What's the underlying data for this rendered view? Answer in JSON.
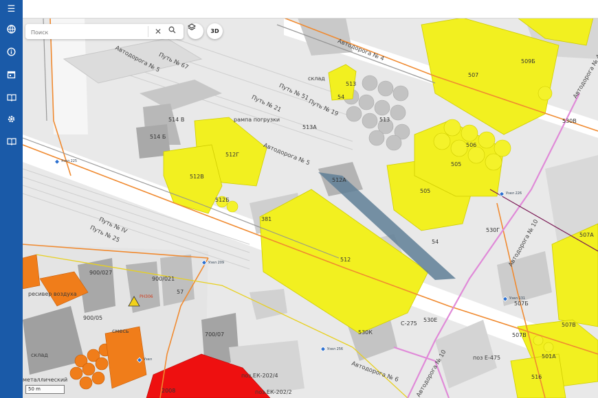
{
  "sidebar": {
    "items": [
      {
        "name": "menu-icon",
        "glyph": "☰"
      },
      {
        "name": "globe-icon",
        "glyph": "🌐"
      },
      {
        "name": "info-icon",
        "glyph": "ⓘ"
      },
      {
        "name": "calendar-icon",
        "glyph": "▦"
      },
      {
        "name": "book-icon",
        "glyph": "📖"
      },
      {
        "name": "settings-icon",
        "glyph": "⚙"
      },
      {
        "name": "book-open-icon",
        "glyph": "📖"
      }
    ],
    "color": "#1a5aa8"
  },
  "search": {
    "placeholder": "Поиск",
    "clear_glyph": "✕"
  },
  "controls": {
    "layers_glyph": "◈",
    "view3d_label": "3D"
  },
  "scale": {
    "label": "50 m"
  },
  "colors": {
    "building": "#f2f020",
    "building_side": "#d8d400",
    "gray_building": "#b5b5b5",
    "orange": "#f07d1a",
    "red": "#ee1010",
    "road_orange": "#f08a30",
    "road_pink": "#e08ad8",
    "shadow": "#5f7f96"
  },
  "labels": {
    "b513": "513",
    "b54": "54",
    "b507": "507",
    "b509b": "509Б",
    "b308": "530В",
    "b514v": "514 В",
    "b514b": "514 Б",
    "b512g": "512Г",
    "b512v": "512В",
    "b512b": "512Б",
    "b513a": "513А",
    "b512a": "512А",
    "b506": "506",
    "b505": "505",
    "b505s": "505",
    "b381": "381",
    "b512": "512",
    "b54b": "54",
    "b530g": "530Г",
    "b507a": "507A",
    "b530k": "530К",
    "c275": "С-275",
    "b530e": "530Е",
    "b507b": "507Б",
    "b501a": "501А",
    "b516": "516",
    "b507v": "507В",
    "b900_027": "900/027",
    "b900_021": "900/021",
    "b57": "57",
    "b900_05": "900/05",
    "b700_07": "700/07",
    "b2008": "2008",
    "receiver": "ресивер воздуха",
    "sklad1": "склад",
    "sklad2": "склад",
    "smes": "смесь",
    "metal": "металлический",
    "pos1": "поз.ЕК-202/4",
    "pos2": "поз.ЕК-202/2",
    "pos3": "поз Е-475",
    "rampa": "рампа погрузки",
    "ph306": "РН306",
    "road4": "Автодорога № 4",
    "road5a": "Автодорога № 5",
    "road5b": "Автодорога № 5",
    "road6": "Автодорога № 6",
    "road4r": "Автодорога № 4",
    "road10": "Автодорога № 10",
    "road10b": "Автодорога № 10",
    "path67": "Путь № 67",
    "path51": "Путь № 51",
    "path19": "Путь № 19",
    "path21": "Путь № 21",
    "path4": "Путь № IV",
    "path25": "Путь № 25",
    "node225": "Узел 225",
    "node209": "Узел 209",
    "node256": "Узел 256",
    "node131": "Узел 131",
    "node226": "Узел 226",
    "node111": "Узел",
    "sklad3": "склад"
  }
}
